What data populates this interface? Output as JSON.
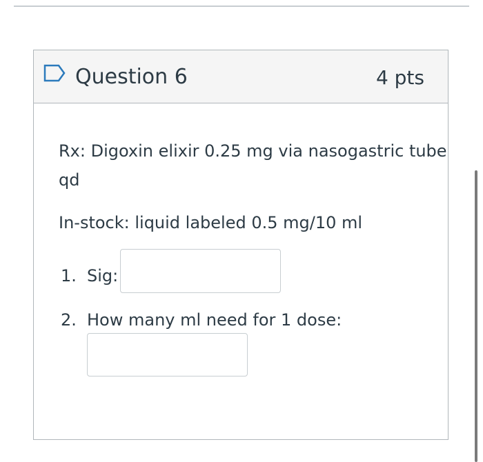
{
  "question": {
    "title": "Question 6",
    "points": "4 pts",
    "flag_icon": "flag-outline-icon"
  },
  "prompt": {
    "rx_line1": "Rx: Digoxin elixir 0.25 mg via nasogastric tube",
    "rx_line2": "qd",
    "instock": "In-stock: liquid labeled 0.5 mg/10 ml"
  },
  "items": [
    {
      "number": "1.",
      "label": "Sig:",
      "value": ""
    },
    {
      "number": "2.",
      "label": "How many ml need for 1 dose:",
      "value": ""
    }
  ]
}
